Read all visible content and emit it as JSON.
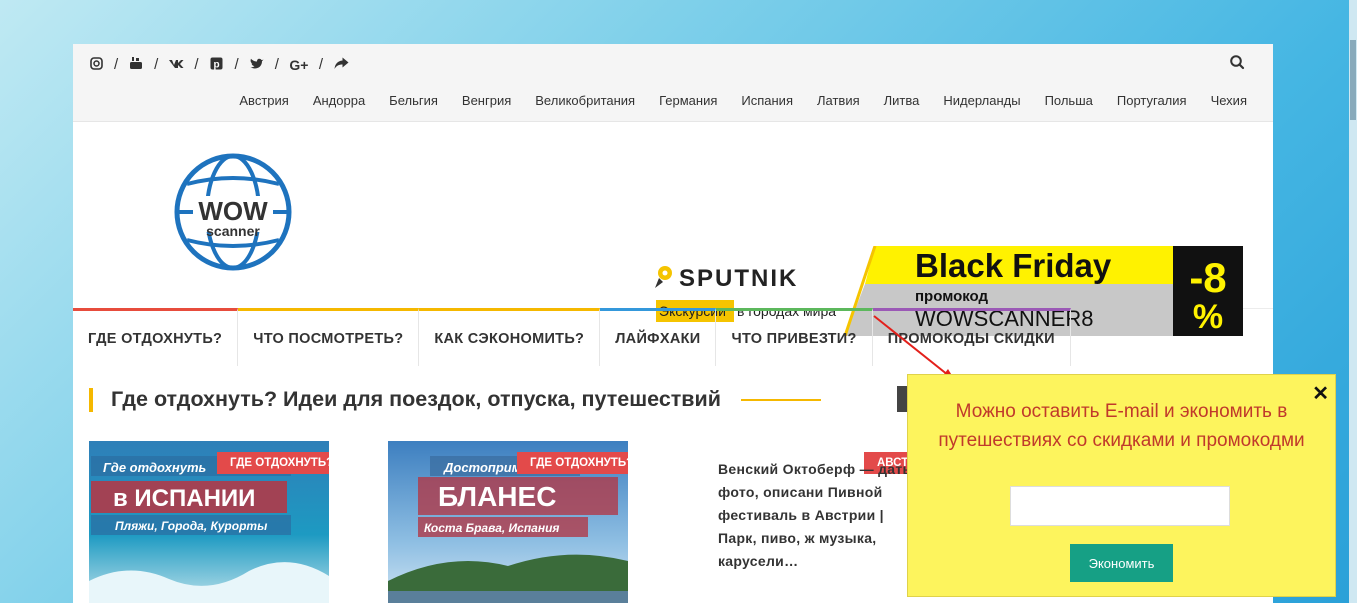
{
  "social": {
    "icons": [
      "instagram-icon",
      "youtube-icon",
      "vk-icon",
      "pinterest-icon",
      "twitter-icon",
      "google-plus-icon",
      "share-icon"
    ],
    "separator": "/"
  },
  "countries": [
    "Австрия",
    "Андорра",
    "Бельгия",
    "Венгрия",
    "Великобритания",
    "Германия",
    "Испания",
    "Латвия",
    "Литва",
    "Нидерланды",
    "Польша",
    "Португалия",
    "Чехия"
  ],
  "logo": {
    "line1": "WOW",
    "line2": "scanner"
  },
  "banner": {
    "brand": "SPUTNIK",
    "sub_highlight": "Экскурсии",
    "sub_rest": "в городах мира",
    "promo_title": "Black Friday",
    "promo_label": "промокод",
    "promo_code": "WOWSCANNER8",
    "discount_num": "-8",
    "discount_pct": "%"
  },
  "menu": [
    {
      "label": "ГДЕ ОТДОХНУТЬ?",
      "color": "#e74c3c"
    },
    {
      "label": "ЧТО ПОСМОТРЕТЬ?",
      "color": "#f5b800"
    },
    {
      "label": "КАК СЭКОНОМИТЬ?",
      "color": "#f5b800"
    },
    {
      "label": "ЛАЙФХАКИ",
      "color": "#3498db"
    },
    {
      "label": "ЧТО ПРИВЕЗТИ?",
      "color": "#5cb85c"
    },
    {
      "label": "ПРОМОКОДЫ СКИДКИ",
      "color": "#9b59b6"
    }
  ],
  "section_title": "Где отдохнуть? Идеи для поездок, отпуска, путешествий",
  "cards": [
    {
      "tag": "ГДЕ ОТДОХНУТЬ?",
      "l1": "Где отдохнуть",
      "l2": "в ИСПАНИИ",
      "l3": "Пляжи, Города, Курорты"
    },
    {
      "tag": "ГДЕ ОТДОХНУТЬ?",
      "l1": "Достоприм",
      "l2": "БЛАНЕС",
      "l3": "Коста Брава, Испания"
    }
  ],
  "third_tag": "АВСТ",
  "article_text": "Венский Октоберф — даты, фото, описани Пивной фестиваль в Австрии | Парк, пиво, ж музыка, карусели…",
  "popup": {
    "message": "Можно оставить E-mail и экономить в путешествиях со скидками и промокодми",
    "close": "✕",
    "input_value": "",
    "button": "Экономить"
  }
}
